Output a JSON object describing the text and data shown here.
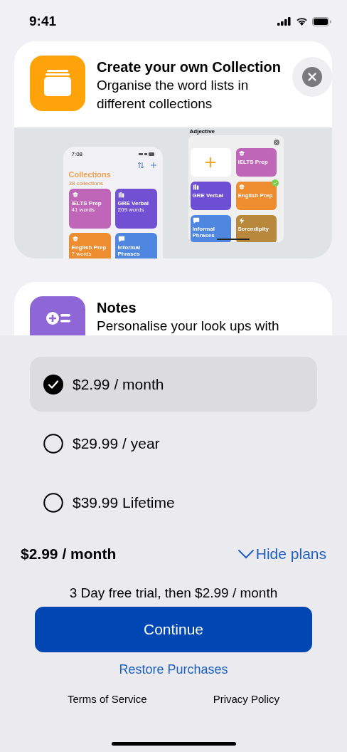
{
  "status_bar": {
    "time": "9:41"
  },
  "features": [
    {
      "title": "Create your own Collection",
      "description": "Organise the word lists in different collections",
      "preview": {
        "phone": {
          "time": "7:08",
          "title": "Collections",
          "count": "38 collections",
          "tiles": [
            {
              "name": "IELTS Prep",
              "words": "41 words",
              "color": "#c066b8"
            },
            {
              "name": "GRE Verbal",
              "words": "209 words",
              "color": "#7150d4"
            },
            {
              "name": "English Prep",
              "words": "7 words",
              "color": "#ee8c30"
            },
            {
              "name": "Informal Phrases",
              "color": "#4f86e0"
            }
          ]
        },
        "picker": {
          "label": "Adjective",
          "tiles": [
            {
              "kind": "add"
            },
            {
              "kind": "tile",
              "name": "IELTS Prep",
              "color": "#c066b8",
              "checked": false
            },
            {
              "kind": "tile",
              "name": "GRE Verbal",
              "color": "#6d4fd4",
              "checked": false
            },
            {
              "kind": "tile",
              "name": "English Prep",
              "color": "#ee8c30",
              "checked": true
            },
            {
              "kind": "tile",
              "name": "Informal Phrases",
              "color": "#4f86e0",
              "checked": false
            },
            {
              "kind": "tile",
              "name": "Serendipity",
              "color": "#b8893c",
              "checked": false
            }
          ]
        }
      }
    },
    {
      "title": "Notes",
      "description": "Personalise your look ups with"
    }
  ],
  "plans": [
    {
      "label": "$2.99 / month",
      "selected": true
    },
    {
      "label": "$29.99 / year",
      "selected": false
    },
    {
      "label": "$39.99 Lifetime",
      "selected": false
    }
  ],
  "summary": {
    "price": "$2.99 / month",
    "toggle": "Hide plans",
    "expanded": true
  },
  "trial": "3 Day free trial, then $2.99 / month",
  "continue": "Continue",
  "restore": "Restore Purchases",
  "links": [
    "Terms of Service",
    "Privacy Policy"
  ]
}
